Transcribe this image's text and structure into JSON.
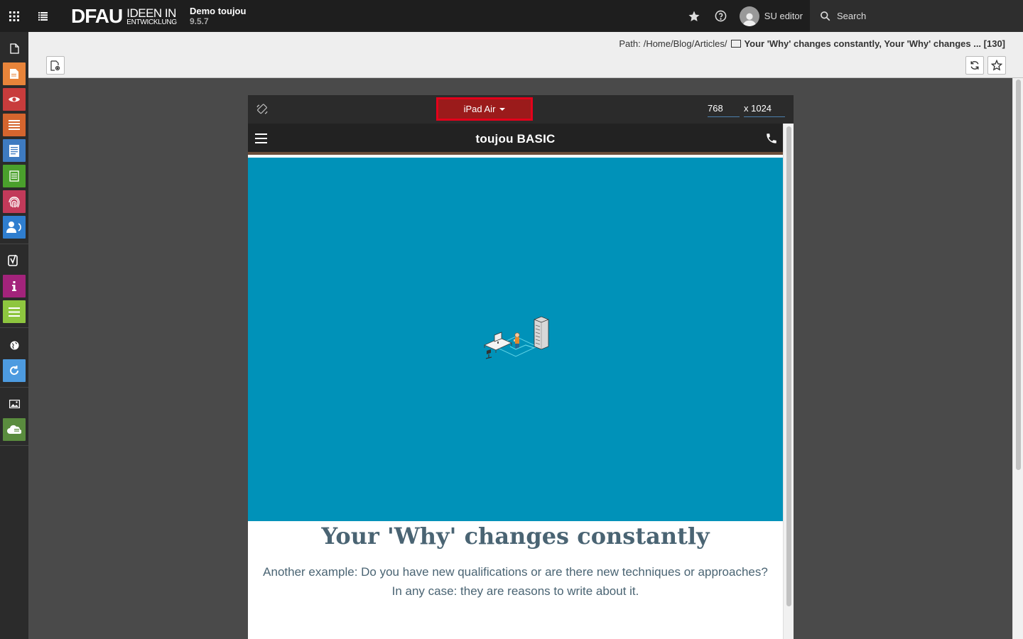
{
  "topbar": {
    "logo_main": "DFAU",
    "logo_sub_1": "IDEEN IN",
    "logo_sub_2": "ENTWICKLUNG",
    "site_name": "Demo toujou",
    "version": "9.5.7",
    "user_name": "SU editor",
    "search_label": "Search"
  },
  "modules": [
    {
      "icon": "page-icon",
      "color": "#2b2b2b"
    },
    {
      "icon": "page-module-icon",
      "color": "#e8843a"
    },
    {
      "icon": "view-icon",
      "color": "#c83c3c"
    },
    {
      "icon": "list-icon",
      "color": "#d5652e"
    },
    {
      "icon": "news-icon",
      "color": "#3e7bc1"
    },
    {
      "icon": "form-icon",
      "color": "#4aa02c"
    },
    {
      "icon": "fingerprint-icon",
      "color": "#c23a5a"
    },
    {
      "icon": "users-icon",
      "color": "#2f7ecf"
    },
    {
      "icon": "yoast-icon",
      "color": "#2b2b2b"
    },
    {
      "icon": "info-icon",
      "color": "#a3237b"
    },
    {
      "icon": "lines-icon",
      "color": "#8ec63f"
    },
    {
      "icon": "globe-icon",
      "color": "#2b2b2b"
    },
    {
      "icon": "refresh-icon",
      "color": "#4d9be0"
    },
    {
      "icon": "image-icon",
      "color": "#2b2b2b"
    },
    {
      "icon": "cloud-icon",
      "color": "#5a8c3e"
    }
  ],
  "docheader": {
    "path_label": "Path:",
    "path_value": "/Home/Blog/Articles/",
    "page_title": "Your 'Why' changes constantly, Your 'Why' changes ... [130]"
  },
  "device": {
    "name": "iPad Air",
    "width": "768",
    "height": "x 1024"
  },
  "preview": {
    "brand": "toujou BASIC",
    "title": "Your 'Why' changes constantly",
    "text": "Another example: Do you have new qualifications or are there new techniques or approaches? In any case: they are reasons to write about it."
  }
}
